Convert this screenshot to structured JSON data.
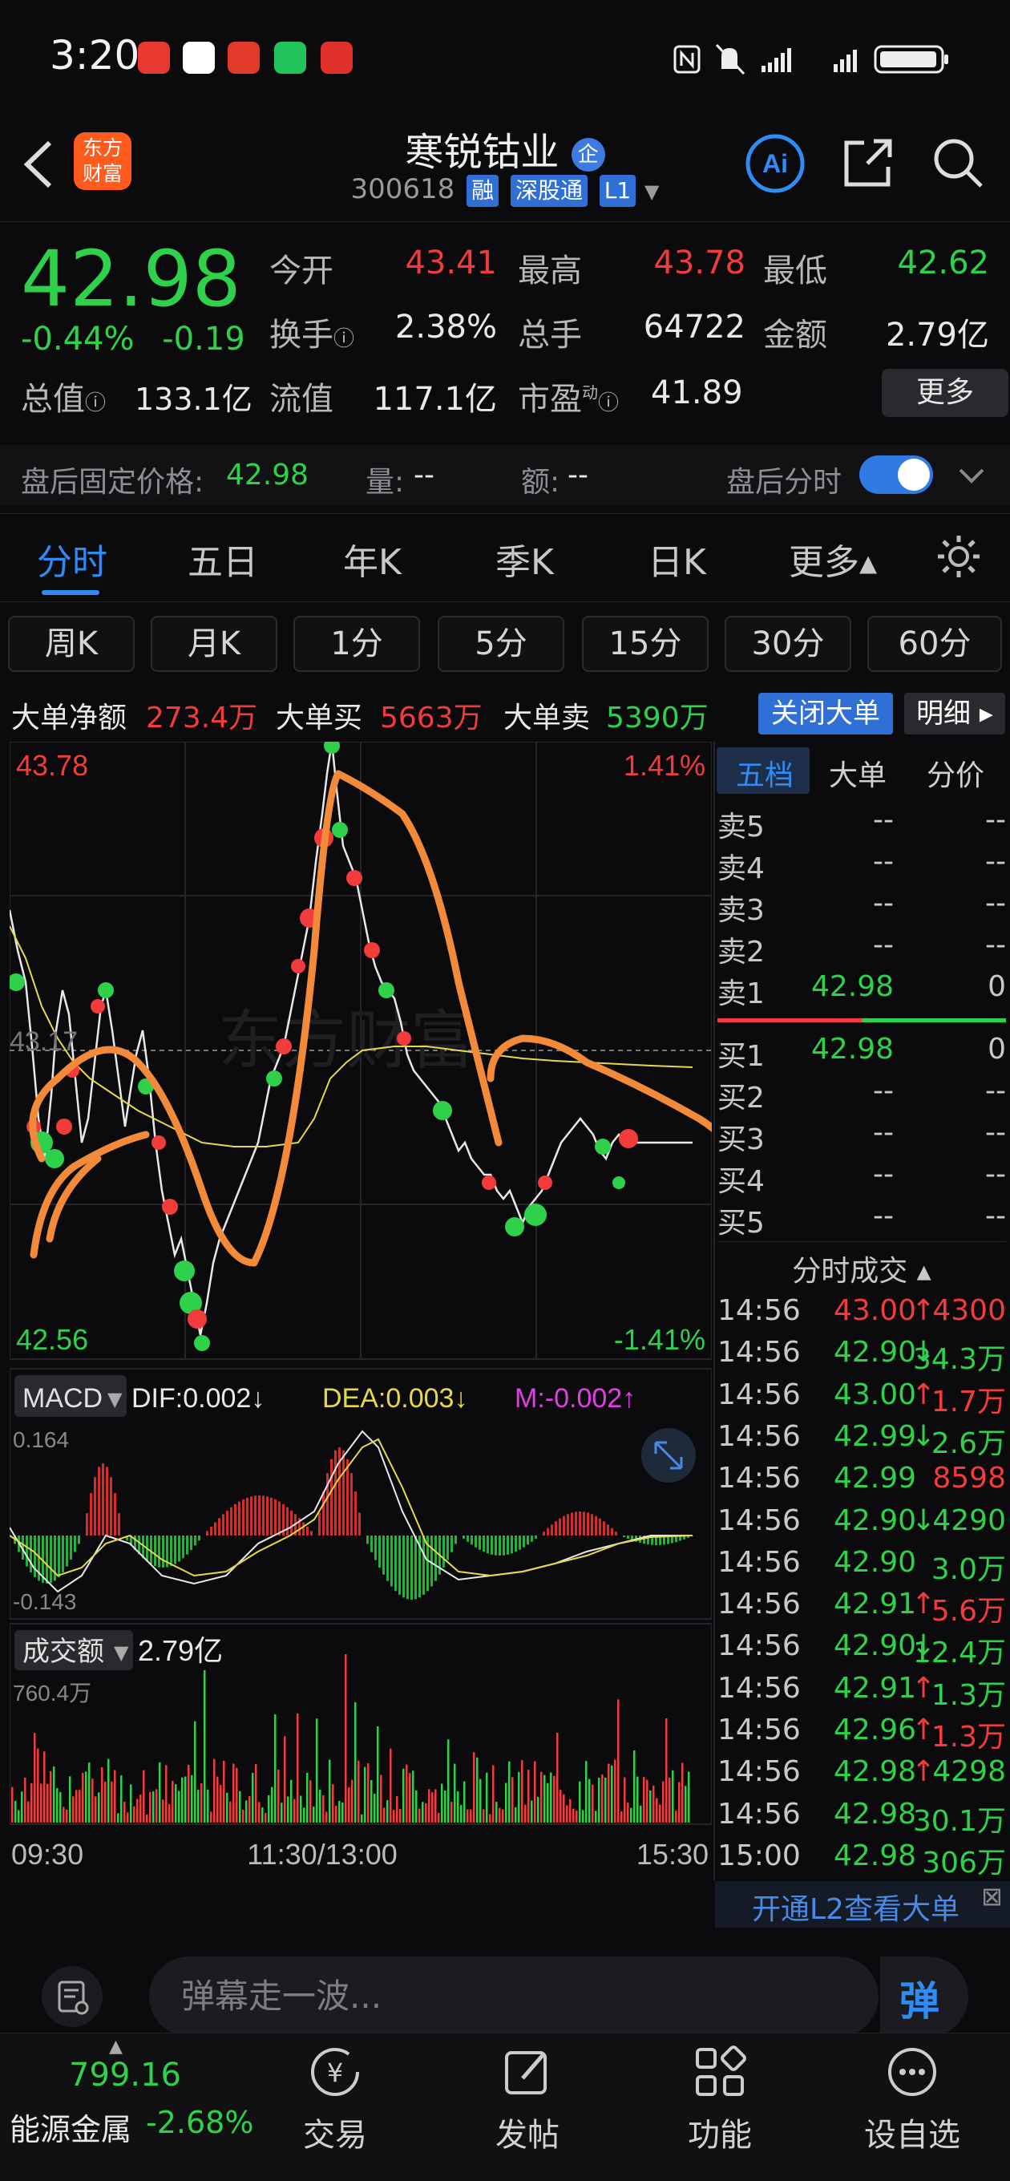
{
  "status": {
    "time": "3:20"
  },
  "header": {
    "name": "寒锐钴业",
    "code": "300618",
    "tags": [
      "融",
      "深股通",
      "L1"
    ],
    "logo_line1": "东方",
    "logo_line2": "财富"
  },
  "quote": {
    "price": "42.98",
    "change_pct": "-0.44%",
    "change": "-0.19",
    "open_label": "今开",
    "open": "43.41",
    "high_label": "最高",
    "high": "43.78",
    "low_label": "最低",
    "low": "42.62",
    "turnover_label": "换手",
    "turnover": "2.38%",
    "volume_label": "总手",
    "volume": "64722",
    "amount_label": "金额",
    "amount": "2.79亿",
    "mktcap_label": "总值",
    "mktcap": "133.1亿",
    "float_label": "流值",
    "float": "117.1亿",
    "pe_label": "市盈",
    "pe_sup": "动",
    "pe": "41.89",
    "more_label": "更多"
  },
  "afterhours": {
    "price_label": "盘后固定价格:",
    "price": "42.98",
    "vol_label": "量:",
    "vol": "--",
    "amt_label": "额:",
    "amt": "--",
    "toggle_label": "盘后分时"
  },
  "tabs": [
    "分时",
    "五日",
    "年K",
    "季K",
    "日K",
    "更多▴"
  ],
  "intervals": [
    "周K",
    "月K",
    "1分",
    "5分",
    "15分",
    "30分",
    "60分"
  ],
  "bigorder": {
    "net_label": "大单净额",
    "net": "273.4万",
    "buy_label": "大单买",
    "buy": "5663万",
    "sell_label": "大单卖",
    "sell": "5390万",
    "close_label": "关闭大单",
    "detail_label": "明细"
  },
  "chart_labels": {
    "top_price": "43.78",
    "top_pct": "1.41%",
    "mid_price": "43.17",
    "bottom_price": "42.56",
    "bottom_pct": "-1.41%",
    "watermark": "东方财富",
    "macd_label": "MACD",
    "dif": "DIF:0.002↓",
    "dea": "DEA:0.003↓",
    "m": "M:-0.002↑",
    "macd_top": "0.164",
    "macd_bottom": "-0.143",
    "vol_label": "成交额",
    "vol_total": "2.79亿",
    "vol_top": "760.4万",
    "time_start": "09:30",
    "time_mid": "11:30/13:00",
    "time_end": "15:30"
  },
  "orderbook_tabs": [
    "五档",
    "大单",
    "分价"
  ],
  "orderbook": {
    "sell": [
      {
        "label": "卖5",
        "price": "--",
        "vol": "--"
      },
      {
        "label": "卖4",
        "price": "--",
        "vol": "--"
      },
      {
        "label": "卖3",
        "price": "--",
        "vol": "--"
      },
      {
        "label": "卖2",
        "price": "--",
        "vol": "--"
      },
      {
        "label": "卖1",
        "price": "42.98",
        "vol": "0"
      }
    ],
    "buy": [
      {
        "label": "买1",
        "price": "42.98",
        "vol": "0"
      },
      {
        "label": "买2",
        "price": "--",
        "vol": "--"
      },
      {
        "label": "买3",
        "price": "--",
        "vol": "--"
      },
      {
        "label": "买4",
        "price": "--",
        "vol": "--"
      },
      {
        "label": "买5",
        "price": "--",
        "vol": "--"
      }
    ]
  },
  "ticks_header": "分时成交 ▴",
  "ticks": [
    {
      "t": "14:56",
      "p": "43.00",
      "a": "↑",
      "v": "4300",
      "pc": "red",
      "vc": "red"
    },
    {
      "t": "14:56",
      "p": "42.90",
      "a": "↓",
      "v": "34.3万",
      "pc": "green",
      "vc": "green"
    },
    {
      "t": "14:56",
      "p": "43.00",
      "a": "↑",
      "v": "1.7万",
      "pc": "green",
      "vc": "red"
    },
    {
      "t": "14:56",
      "p": "42.99",
      "a": "↓",
      "v": "2.6万",
      "pc": "green",
      "vc": "green"
    },
    {
      "t": "14:56",
      "p": "42.99",
      "a": "",
      "v": "8598",
      "pc": "green",
      "vc": "red"
    },
    {
      "t": "14:56",
      "p": "42.90",
      "a": "↓",
      "v": "4290",
      "pc": "green",
      "vc": "green"
    },
    {
      "t": "14:56",
      "p": "42.90",
      "a": "",
      "v": "3.0万",
      "pc": "green",
      "vc": "green"
    },
    {
      "t": "14:56",
      "p": "42.91",
      "a": "↑",
      "v": "5.6万",
      "pc": "green",
      "vc": "red"
    },
    {
      "t": "14:56",
      "p": "42.90",
      "a": "↓",
      "v": "12.4万",
      "pc": "green",
      "vc": "green"
    },
    {
      "t": "14:56",
      "p": "42.91",
      "a": "↑",
      "v": "1.3万",
      "pc": "green",
      "vc": "green"
    },
    {
      "t": "14:56",
      "p": "42.96",
      "a": "↑",
      "v": "1.3万",
      "pc": "green",
      "vc": "red"
    },
    {
      "t": "14:56",
      "p": "42.98",
      "a": "↑",
      "v": "4298",
      "pc": "green",
      "vc": "green"
    },
    {
      "t": "14:56",
      "p": "42.98",
      "a": "",
      "v": "30.1万",
      "pc": "green",
      "vc": "green"
    },
    {
      "t": "15:00",
      "p": "42.98",
      "a": "",
      "v": "306万",
      "pc": "green",
      "vc": "green"
    }
  ],
  "l2_banner": "开通L2查看大单",
  "danmu_placeholder": "弹幕走一波...",
  "danmu_button": "弹",
  "nav": {
    "index_value": "799.16",
    "index_name": "能源金属",
    "index_pct": "-2.68%",
    "items": [
      "交易",
      "发帖",
      "功能",
      "设自选"
    ]
  },
  "colors": {
    "up": "#f23b3b",
    "down": "#2fd14a",
    "accent": "#2f8cf5",
    "avg": "#e6d84a",
    "annotation": "#f28a3a"
  }
}
